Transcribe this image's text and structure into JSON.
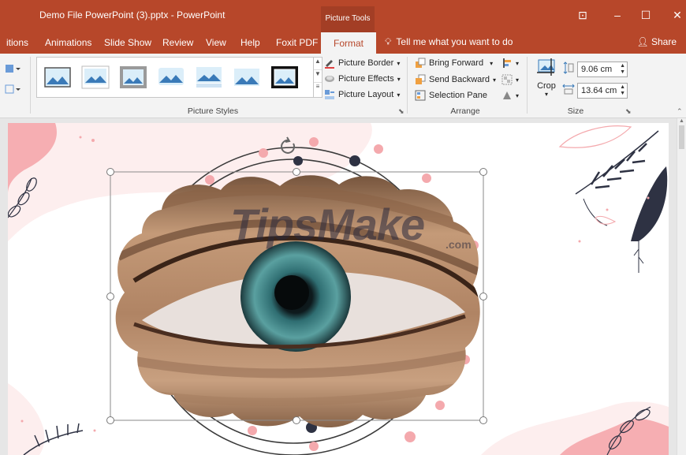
{
  "window": {
    "doc_title": "Demo File PowerPoint (3).pptx  -  PowerPoint",
    "context_tab_group": "Picture Tools"
  },
  "tabs": [
    {
      "label": "itions"
    },
    {
      "label": "Animations"
    },
    {
      "label": "Slide Show"
    },
    {
      "label": "Review"
    },
    {
      "label": "View"
    },
    {
      "label": "Help"
    },
    {
      "label": "Foxit PDF"
    },
    {
      "label": "Format",
      "active": true
    }
  ],
  "tell_me": "Tell me what you want to do",
  "share": "Share",
  "ribbon": {
    "picture_styles": {
      "label": "Picture Styles",
      "border": "Picture Border",
      "effects": "Picture Effects",
      "layout": "Picture Layout"
    },
    "arrange": {
      "label": "Arrange",
      "bring_forward": "Bring Forward",
      "send_backward": "Send Backward",
      "selection_pane": "Selection Pane"
    },
    "size": {
      "label": "Size",
      "crop": "Crop",
      "height": "9.06 cm",
      "width": "13.64 cm"
    }
  },
  "slide": {
    "watermark": "TipsMake",
    "watermark_suffix": ".com"
  },
  "colors": {
    "accent": "#b7472a",
    "accent_dark": "#a33e25",
    "pink": "#f4a9ad",
    "navy": "#2e3243"
  }
}
